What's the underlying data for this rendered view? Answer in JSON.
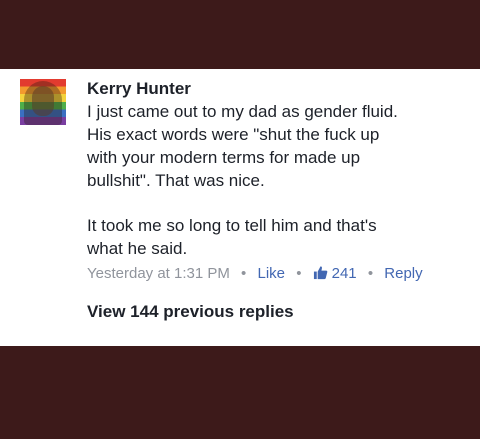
{
  "comment": {
    "author": "Kerry Hunter",
    "paragraph1": "I just came out to my dad as gender fluid.\nHis exact words were \"shut the fuck up\nwith your modern terms for made up\nbullshit\". That was nice.",
    "paragraph2": "It took me so long to tell him and that's\nwhat he said.",
    "timestamp": "Yesterday at 1:31 PM",
    "like_label": "Like",
    "like_count": "241",
    "reply_label": "Reply",
    "separator": "•"
  },
  "view_previous_replies": "View 144 previous replies",
  "colors": {
    "background": "#3d1a1a",
    "link": "#4267b2",
    "meta_gray": "#90949c",
    "text": "#1d2129"
  },
  "icons": {
    "avatar": "rainbow-profile-photo",
    "reaction": "thumbs-up-icon"
  }
}
